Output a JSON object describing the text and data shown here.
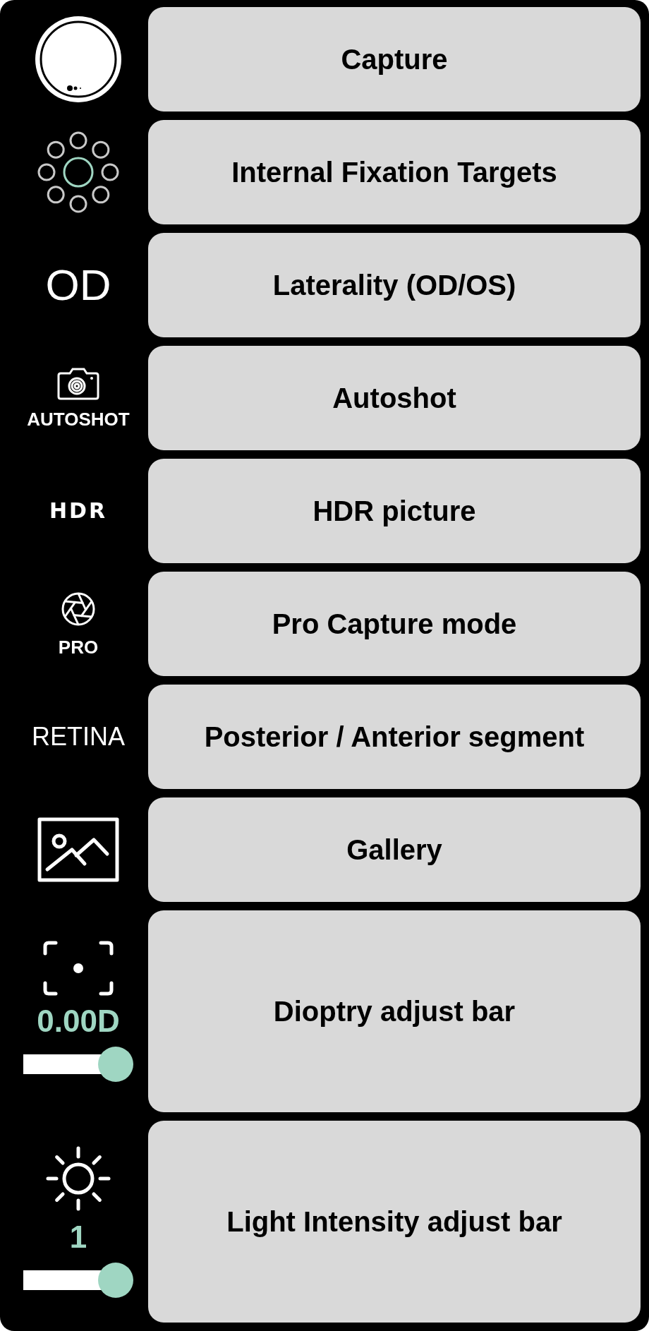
{
  "rows": [
    {
      "label": "Capture",
      "control": {
        "kind": "capture"
      }
    },
    {
      "label": "Internal Fixation Targets",
      "control": {
        "kind": "fixation"
      }
    },
    {
      "label": "Laterality (OD/OS)",
      "control": {
        "kind": "large-text",
        "text": "OD"
      }
    },
    {
      "label": "Autoshot",
      "control": {
        "kind": "camera",
        "caption": "AUTOSHOT"
      }
    },
    {
      "label": "HDR picture",
      "control": {
        "kind": "bold-text",
        "text": "HDR"
      }
    },
    {
      "label": "Pro Capture mode",
      "control": {
        "kind": "aperture",
        "caption": "PRO"
      }
    },
    {
      "label": "Posterior / Anterior segment",
      "control": {
        "kind": "plain-text",
        "text": "RETINA"
      }
    },
    {
      "label": "Gallery",
      "control": {
        "kind": "gallery"
      }
    },
    {
      "label": "Dioptry adjust bar",
      "control": {
        "kind": "focus-slider",
        "reading": "0.00D",
        "level": 1
      }
    },
    {
      "label": "Light Intensity adjust bar",
      "control": {
        "kind": "light-slider",
        "reading": "1",
        "level": 1
      }
    }
  ]
}
